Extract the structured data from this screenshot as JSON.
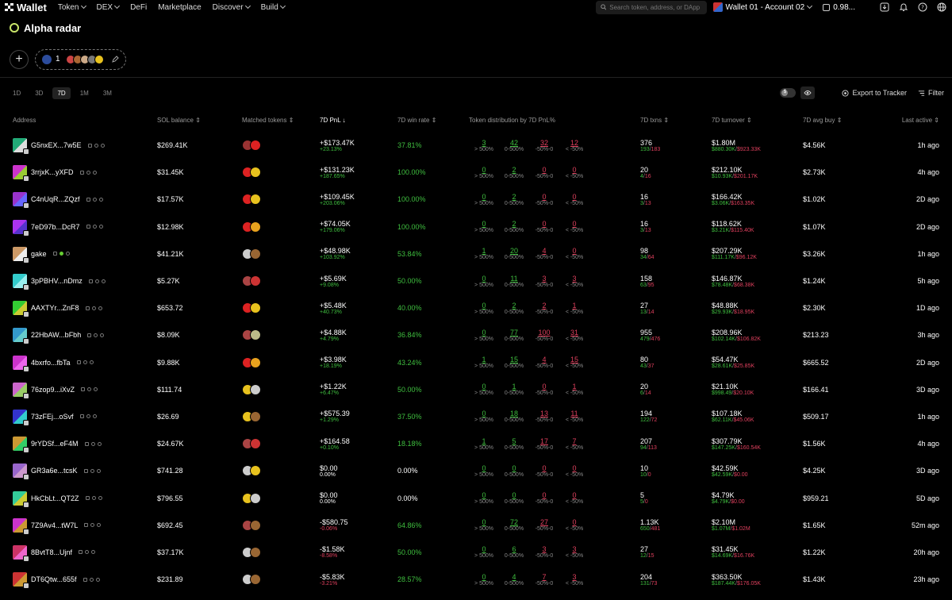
{
  "nav": {
    "brand": "Wallet",
    "items": [
      {
        "label": "Token",
        "dropdown": true
      },
      {
        "label": "DEX",
        "dropdown": true
      },
      {
        "label": "DeFi",
        "dropdown": false
      },
      {
        "label": "Marketplace",
        "dropdown": false
      },
      {
        "label": "Discover",
        "dropdown": true
      },
      {
        "label": "Build",
        "dropdown": true
      }
    ],
    "search_placeholder": "Search token, address, or DApp",
    "account": "Wallet 01 - Account 02",
    "balance": "0.98..."
  },
  "page": {
    "title": "Alpha radar",
    "group_count": "1"
  },
  "toolbar": {
    "timeframes": [
      "1D",
      "3D",
      "7D",
      "1M",
      "3M"
    ],
    "active_timeframe": "7D",
    "toggle_label": "$",
    "export_label": "Export to Tracker",
    "filter_label": "Filter"
  },
  "columns": {
    "address": "Address",
    "sol_balance": "SOL balance",
    "matched_tokens": "Matched tokens",
    "pnl": "7D PnL",
    "win_rate": "7D win rate",
    "distribution": "Token distribution by 7D PnL%",
    "txns": "7D txns",
    "turnover": "7D turnover",
    "avg_buy": "7D avg buy",
    "last_active": "Last active"
  },
  "dist_labels": [
    "> 500%",
    "0-500%",
    "-50%-0",
    "< -50%"
  ],
  "colors": {
    "green": "#3fbf3f",
    "red": "#e0405e",
    "accent": "#c9e66a"
  },
  "rows": [
    {
      "addr": "G5nxEX...7w5E",
      "sol": "$269.41K",
      "pnl": "+$173.47K",
      "pnl_pct": "+23.13%",
      "pnl_dir": "up",
      "win": "37.81%",
      "win_color": "green",
      "dist": [
        "3",
        "42",
        "32",
        "12"
      ],
      "txns": "376",
      "buys": "193",
      "sells": "183",
      "turnover": "$1.80M",
      "buy_vol": "$880.30K",
      "sell_vol": "$923.33K",
      "avg": "$4.56K",
      "last": "1h ago",
      "avc": [
        "#2a7",
        "#ddd"
      ],
      "toks": [
        "#933",
        "#d22"
      ]
    },
    {
      "addr": "3rrjxK...yXFD",
      "sol": "$31.45K",
      "pnl": "+$131.23K",
      "pnl_pct": "+187.65%",
      "pnl_dir": "up",
      "win": "100.00%",
      "win_color": "green",
      "dist": [
        "0",
        "2",
        "0",
        "0"
      ],
      "txns": "20",
      "buys": "4",
      "sells": "16",
      "turnover": "$212.10K",
      "buy_vol": "$10.93K",
      "sell_vol": "$201.17K",
      "avg": "$2.73K",
      "last": "4h ago",
      "avc": [
        "#c3c",
        "#9c3"
      ],
      "toks": [
        "#d22",
        "#e8c21e"
      ]
    },
    {
      "addr": "C4nUqR...ZQzf",
      "sol": "$17.57K",
      "pnl": "+$109.45K",
      "pnl_pct": "+203.06%",
      "pnl_dir": "up",
      "win": "100.00%",
      "win_color": "green",
      "dist": [
        "0",
        "2",
        "0",
        "0"
      ],
      "txns": "16",
      "buys": "3",
      "sells": "13",
      "turnover": "$166.42K",
      "buy_vol": "$3.06K",
      "sell_vol": "$163.35K",
      "avg": "$1.02K",
      "last": "2D ago",
      "avc": [
        "#93c",
        "#66f"
      ],
      "toks": [
        "#d22",
        "#e8c21e"
      ]
    },
    {
      "addr": "7eD97b...DcR7",
      "sol": "$12.98K",
      "pnl": "+$74.05K",
      "pnl_pct": "+179.06%",
      "pnl_dir": "up",
      "win": "100.00%",
      "win_color": "green",
      "dist": [
        "0",
        "2",
        "0",
        "0"
      ],
      "txns": "16",
      "buys": "3",
      "sells": "13",
      "turnover": "$118.62K",
      "buy_vol": "$3.21K",
      "sell_vol": "$115.40K",
      "avg": "$1.07K",
      "last": "2D ago",
      "avc": [
        "#a3e",
        "#53c"
      ],
      "toks": [
        "#d22",
        "#e8a21e"
      ]
    },
    {
      "addr": "gake",
      "sol": "$41.21K",
      "pnl": "+$48.98K",
      "pnl_pct": "+103.92%",
      "pnl_dir": "up",
      "win": "53.84%",
      "win_color": "green",
      "dist": [
        "1",
        "20",
        "4",
        "0"
      ],
      "txns": "98",
      "buys": "34",
      "sells": "64",
      "turnover": "$207.29K",
      "buy_vol": "$111.17K",
      "sell_vol": "$96.12K",
      "avg": "$3.26K",
      "last": "1h ago",
      "avc": [
        "#c96",
        "#eee"
      ],
      "toks": [
        "#ccc",
        "#963"
      ]
    },
    {
      "addr": "3pPBHV...nDmz",
      "sol": "$5.27K",
      "pnl": "+$5.69K",
      "pnl_pct": "+9.08%",
      "pnl_dir": "up",
      "win": "50.00%",
      "win_color": "green",
      "dist": [
        "0",
        "11",
        "3",
        "3"
      ],
      "txns": "158",
      "buys": "63",
      "sells": "95",
      "turnover": "$146.87K",
      "buy_vol": "$78.48K",
      "sell_vol": "$68.38K",
      "avg": "$1.24K",
      "last": "5h ago",
      "avc": [
        "#3cc",
        "#9ee"
      ],
      "toks": [
        "#a44",
        "#c33"
      ]
    },
    {
      "addr": "AAXTYr...ZnF8",
      "sol": "$653.72",
      "pnl": "+$5.48K",
      "pnl_pct": "+40.73%",
      "pnl_dir": "up",
      "win": "40.00%",
      "win_color": "green",
      "dist": [
        "0",
        "2",
        "2",
        "1"
      ],
      "txns": "27",
      "buys": "13",
      "sells": "14",
      "turnover": "$48.88K",
      "buy_vol": "$29.93K",
      "sell_vol": "$18.95K",
      "avg": "$2.30K",
      "last": "1D ago",
      "avc": [
        "#3c3",
        "#cc3"
      ],
      "toks": [
        "#d22",
        "#e8c21e"
      ]
    },
    {
      "addr": "22HbAW...bFbh",
      "sol": "$8.09K",
      "pnl": "+$4.88K",
      "pnl_pct": "+4.79%",
      "pnl_dir": "up",
      "win": "36.84%",
      "win_color": "green",
      "dist": [
        "0",
        "77",
        "100",
        "31"
      ],
      "txns": "955",
      "buys": "479",
      "sells": "476",
      "turnover": "$208.96K",
      "buy_vol": "$102.14K",
      "sell_vol": "$106.82K",
      "avg": "$213.23",
      "last": "3h ago",
      "avc": [
        "#39c",
        "#6cc"
      ],
      "toks": [
        "#a44",
        "#bb8"
      ]
    },
    {
      "addr": "4bxrfo...fbTa",
      "sol": "$9.88K",
      "pnl": "+$3.98K",
      "pnl_pct": "+18.19%",
      "pnl_dir": "up",
      "win": "43.24%",
      "win_color": "green",
      "dist": [
        "1",
        "15",
        "4",
        "15"
      ],
      "txns": "80",
      "buys": "43",
      "sells": "37",
      "turnover": "$54.47K",
      "buy_vol": "$28.61K",
      "sell_vol": "$25.85K",
      "avg": "$665.52",
      "last": "2D ago",
      "avc": [
        "#c3c",
        "#e6e"
      ],
      "toks": [
        "#d22",
        "#e8a21e"
      ]
    },
    {
      "addr": "76zop9...iXvZ",
      "sol": "$111.74",
      "pnl": "+$1.22K",
      "pnl_pct": "+6.47%",
      "pnl_dir": "up",
      "win": "50.00%",
      "win_color": "green",
      "dist": [
        "0",
        "1",
        "0",
        "1"
      ],
      "txns": "20",
      "buys": "6",
      "sells": "14",
      "turnover": "$21.10K",
      "buy_vol": "$998.49",
      "sell_vol": "$20.10K",
      "avg": "$166.41",
      "last": "3D ago",
      "avc": [
        "#c6c",
        "#9c6"
      ],
      "toks": [
        "#e8c21e",
        "#ccc"
      ]
    },
    {
      "addr": "73zFEj...oSvf",
      "sol": "$26.69",
      "pnl": "+$575.39",
      "pnl_pct": "+1.29%",
      "pnl_dir": "up",
      "win": "37.50%",
      "win_color": "green",
      "dist": [
        "0",
        "18",
        "13",
        "11"
      ],
      "txns": "194",
      "buys": "122",
      "sells": "72",
      "turnover": "$107.18K",
      "buy_vol": "$62.11K",
      "sell_vol": "$45.06K",
      "avg": "$509.17",
      "last": "1h ago",
      "avc": [
        "#33c",
        "#3cc"
      ],
      "toks": [
        "#e8c21e",
        "#963"
      ]
    },
    {
      "addr": "9rYDSf...eF4M",
      "sol": "$24.67K",
      "pnl": "+$164.58",
      "pnl_pct": "+0.10%",
      "pnl_dir": "up",
      "win": "18.18%",
      "win_color": "green",
      "dist": [
        "1",
        "5",
        "17",
        "7"
      ],
      "txns": "207",
      "buys": "94",
      "sells": "113",
      "turnover": "$307.79K",
      "buy_vol": "$147.25K",
      "sell_vol": "$160.54K",
      "avg": "$1.56K",
      "last": "4h ago",
      "avc": [
        "#c93",
        "#3c6"
      ],
      "toks": [
        "#a44",
        "#c33"
      ]
    },
    {
      "addr": "GR3a6e...tcsK",
      "sol": "$741.28",
      "pnl": "$0.00",
      "pnl_pct": "0.00%",
      "pnl_dir": "flat",
      "win": "0.00%",
      "win_color": "white",
      "dist": [
        "0",
        "0",
        "0",
        "0"
      ],
      "txns": "10",
      "buys": "10",
      "sells": "0",
      "turnover": "$42.59K",
      "buy_vol": "$42.59K",
      "sell_vol": "$0.00",
      "avg": "$4.25K",
      "last": "3D ago",
      "avc": [
        "#96c",
        "#c9c"
      ],
      "toks": [
        "#ccc",
        "#e8c21e"
      ]
    },
    {
      "addr": "HkCbLt...QT2Z",
      "sol": "$796.55",
      "pnl": "$0.00",
      "pnl_pct": "0.00%",
      "pnl_dir": "flat",
      "win": "0.00%",
      "win_color": "white",
      "dist": [
        "0",
        "0",
        "0",
        "0"
      ],
      "txns": "5",
      "buys": "5",
      "sells": "0",
      "turnover": "$4.79K",
      "buy_vol": "$4.79K",
      "sell_vol": "$0.00",
      "avg": "$959.21",
      "last": "5D ago",
      "avc": [
        "#3c9",
        "#cc3"
      ],
      "toks": [
        "#e8c21e",
        "#ccc"
      ]
    },
    {
      "addr": "7Z9Av4...tW7L",
      "sol": "$692.45",
      "pnl": "-$580.75",
      "pnl_pct": "-0.06%",
      "pnl_dir": "down",
      "win": "64.86%",
      "win_color": "green",
      "dist": [
        "0",
        "72",
        "27",
        "0"
      ],
      "txns": "1.13K",
      "buys": "650",
      "sells": "481",
      "turnover": "$2.10M",
      "buy_vol": "$1.07M",
      "sell_vol": "$1.02M",
      "avg": "$1.65K",
      "last": "52m ago",
      "avc": [
        "#c3c",
        "#c93"
      ],
      "toks": [
        "#a44",
        "#963"
      ]
    },
    {
      "addr": "8BvtT8...Ujnf",
      "sol": "$37.17K",
      "pnl": "-$1.58K",
      "pnl_pct": "-8.58%",
      "pnl_dir": "down",
      "win": "50.00%",
      "win_color": "green",
      "dist": [
        "0",
        "6",
        "3",
        "3"
      ],
      "txns": "27",
      "buys": "12",
      "sells": "15",
      "turnover": "$31.45K",
      "buy_vol": "$14.69K",
      "sell_vol": "$16.76K",
      "avg": "$1.22K",
      "last": "20h ago",
      "avc": [
        "#c36",
        "#e6c"
      ],
      "toks": [
        "#ccc",
        "#963"
      ]
    },
    {
      "addr": "DT6Qtw...655f",
      "sol": "$231.89",
      "pnl": "-$5.83K",
      "pnl_pct": "-3.21%",
      "pnl_dir": "down",
      "win": "28.57%",
      "win_color": "green",
      "dist": [
        "0",
        "4",
        "7",
        "3"
      ],
      "txns": "204",
      "buys": "131",
      "sells": "73",
      "turnover": "$363.50K",
      "buy_vol": "$187.44K",
      "sell_vol": "$176.05K",
      "avg": "$1.43K",
      "last": "23h ago",
      "avc": [
        "#c33",
        "#c93"
      ],
      "toks": [
        "#ccc",
        "#963"
      ]
    }
  ]
}
